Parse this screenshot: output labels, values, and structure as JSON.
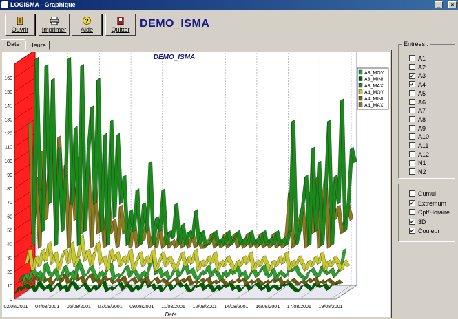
{
  "window": {
    "title": "LOGISMA - Graphique"
  },
  "toolbar": [
    {
      "label": "Ouvrir",
      "icon": "open-door-icon"
    },
    {
      "label": "Imprimer",
      "icon": "printer-icon"
    },
    {
      "label": "Aide",
      "icon": "help-icon"
    },
    {
      "label": "Quitter",
      "icon": "exit-door-icon"
    }
  ],
  "header": {
    "title": "DEMO_ISMA"
  },
  "tabs": [
    {
      "label": "Date",
      "active": true
    },
    {
      "label": "Heure",
      "active": false
    }
  ],
  "entries": {
    "title": "Entrées :",
    "items": [
      {
        "label": "A1",
        "checked": false
      },
      {
        "label": "A2",
        "checked": false
      },
      {
        "label": "A3",
        "checked": true
      },
      {
        "label": "A4",
        "checked": true
      },
      {
        "label": "A5",
        "checked": false
      },
      {
        "label": "A6",
        "checked": false
      },
      {
        "label": "A7",
        "checked": false
      },
      {
        "label": "A8",
        "checked": false
      },
      {
        "label": "A9",
        "checked": false
      },
      {
        "label": "A10",
        "checked": false
      },
      {
        "label": "A11",
        "checked": false
      },
      {
        "label": "A12",
        "checked": false
      },
      {
        "label": "N1",
        "checked": false
      },
      {
        "label": "N2",
        "checked": false
      }
    ]
  },
  "options": {
    "items": [
      {
        "label": "Cumul",
        "checked": false
      },
      {
        "label": "Extremum",
        "checked": true
      },
      {
        "label": "Cpt/Horaire",
        "checked": false
      },
      {
        "label": "3D",
        "checked": true
      },
      {
        "label": "Couleur",
        "checked": true
      }
    ]
  },
  "chart_data": {
    "type": "line",
    "title": "DEMO_ISMA",
    "xlabel": "Date",
    "ylabel": "",
    "ylim": [
      0,
      170
    ],
    "yticks": [
      0,
      10,
      20,
      30,
      40,
      50,
      60,
      70,
      80,
      90,
      100,
      110,
      120,
      130,
      140,
      150,
      160
    ],
    "categories": [
      "02/08/2001",
      "04/08/2001",
      "06/08/2001",
      "07/08/2001",
      "09/08/2001",
      "11/08/2001",
      "12/08/2001",
      "14/08/2001",
      "16/08/2001",
      "17/08/2001",
      "19/08/2001"
    ],
    "colors": {
      "wall": "#ff2020",
      "gridline": "#a0a0a0",
      "background": "#ffffff"
    },
    "series": [
      {
        "name": "A3_MOY",
        "color": "#30a030",
        "values": [
          8,
          14,
          10,
          18,
          12,
          16,
          9,
          22,
          15,
          12,
          18,
          10,
          14,
          20,
          12,
          16,
          10,
          24,
          18,
          12,
          15,
          20,
          14,
          10,
          16,
          12,
          18,
          22,
          10,
          14,
          12,
          16,
          20,
          12,
          18,
          14,
          10,
          16,
          12,
          20,
          28,
          14,
          18,
          12,
          16,
          10,
          14,
          20,
          12,
          16,
          22,
          14,
          18,
          12,
          10,
          16,
          14,
          20,
          12,
          18,
          14,
          10,
          16,
          12,
          18,
          14,
          20,
          12,
          16,
          10,
          14,
          18,
          12,
          16,
          20,
          14,
          12,
          18,
          10,
          16,
          14,
          12,
          18,
          16,
          20,
          14,
          12,
          10,
          16,
          18,
          14,
          12,
          20,
          16,
          14,
          18,
          12,
          16,
          20,
          32
        ]
      },
      {
        "name": "A3_MINI",
        "color": "#006000",
        "values": [
          4,
          8,
          6,
          10,
          7,
          9,
          5,
          12,
          8,
          6,
          10,
          5,
          8,
          11,
          6,
          9,
          5,
          12,
          10,
          6,
          8,
          11,
          7,
          5,
          9,
          6,
          10,
          12,
          5,
          8,
          6,
          9,
          11,
          6,
          10,
          8,
          5,
          9,
          6,
          11,
          14,
          8,
          10,
          6,
          9,
          5,
          8,
          11,
          6,
          9,
          12,
          8,
          10,
          6,
          5,
          9,
          8,
          11,
          6,
          10,
          8,
          5,
          9,
          6,
          10,
          8,
          11,
          6,
          9,
          5,
          8,
          10,
          6,
          9,
          11,
          8,
          6,
          10,
          5,
          9,
          8,
          6,
          10,
          9,
          11,
          8,
          6,
          5,
          9,
          10,
          8,
          6,
          11,
          9,
          8,
          10,
          6,
          9,
          11,
          10
        ]
      },
      {
        "name": "A3_MAXI",
        "color": "#1a8a1a",
        "values": [
          30,
          165,
          70,
          40,
          160,
          60,
          150,
          30,
          100,
          40,
          80,
          165,
          60,
          115,
          30,
          160,
          40,
          100,
          130,
          60,
          150,
          40,
          110,
          30,
          120,
          50,
          110,
          60,
          80,
          30,
          55,
          40,
          70,
          30,
          60,
          40,
          90,
          30,
          50,
          40,
          70,
          30,
          40,
          35,
          60,
          30,
          45,
          30,
          40,
          35,
          55,
          30,
          40,
          30,
          30,
          35,
          40,
          30,
          35,
          30,
          40,
          30,
          35,
          40,
          30,
          35,
          30,
          40,
          30,
          35,
          30,
          40,
          30,
          35,
          30,
          40,
          30,
          35,
          30,
          40,
          120,
          30,
          40,
          60,
          80,
          30,
          100,
          40,
          90,
          30,
          70,
          120,
          30,
          80,
          60,
          135,
          40,
          60,
          100,
          90
        ]
      },
      {
        "name": "A4_MOY",
        "color": "#c8c830",
        "values": [
          20,
          30,
          15,
          25,
          18,
          30,
          22,
          35,
          20,
          28,
          15,
          25,
          30,
          20,
          35,
          18,
          25,
          40,
          22,
          30,
          18,
          28,
          35,
          20,
          25,
          15,
          30,
          22,
          28,
          18,
          25,
          20,
          30,
          15,
          22,
          28,
          18,
          25,
          20,
          30,
          15,
          22,
          28,
          18,
          25,
          20,
          15,
          22,
          28,
          18,
          25,
          20,
          30,
          15,
          22,
          18,
          25,
          20,
          28,
          15,
          22,
          18,
          25,
          20,
          15,
          22,
          18,
          25,
          20,
          28,
          15,
          22,
          18,
          25,
          20,
          15,
          22,
          18,
          25,
          20,
          28,
          15,
          22,
          18,
          25,
          20,
          15,
          22,
          18,
          25,
          20,
          28,
          15,
          22,
          18,
          25,
          20,
          15,
          22,
          18
        ]
      },
      {
        "name": "A4_MINI",
        "color": "#706010",
        "values": [
          10,
          15,
          8,
          12,
          9,
          14,
          11,
          16,
          10,
          13,
          8,
          12,
          14,
          10,
          16,
          9,
          12,
          18,
          11,
          14,
          9,
          13,
          16,
          10,
          12,
          8,
          14,
          11,
          13,
          9,
          12,
          10,
          14,
          8,
          11,
          13,
          9,
          12,
          10,
          14,
          8,
          11,
          13,
          9,
          12,
          10,
          8,
          11,
          13,
          9,
          12,
          10,
          14,
          8,
          11,
          9,
          12,
          10,
          13,
          8,
          11,
          9,
          12,
          10,
          8,
          11,
          9,
          12,
          10,
          13,
          8,
          11,
          9,
          12,
          10,
          8,
          11,
          9,
          12,
          10,
          13,
          8,
          11,
          9,
          12,
          10,
          8,
          11,
          9,
          12,
          10,
          13,
          8,
          11,
          9,
          12,
          10,
          8,
          11,
          9
        ]
      },
      {
        "name": "A4_MAXI",
        "color": "#8a7a20",
        "values": [
          120,
          40,
          80,
          30,
          100,
          50,
          90,
          115,
          40,
          110,
          60,
          90,
          30,
          85,
          50,
          95,
          40,
          70,
          90,
          30,
          80,
          40,
          60,
          30,
          70,
          40,
          50,
          30,
          60,
          40,
          45,
          30,
          50,
          30,
          40,
          35,
          50,
          30,
          40,
          30,
          45,
          30,
          40,
          30,
          35,
          30,
          40,
          30,
          35,
          30,
          40,
          30,
          35,
          30,
          30,
          35,
          40,
          30,
          35,
          30,
          40,
          30,
          35,
          40,
          30,
          35,
          30,
          40,
          30,
          35,
          30,
          40,
          30,
          35,
          30,
          40,
          30,
          35,
          30,
          40,
          70,
          30,
          40,
          50,
          60,
          30,
          70,
          40,
          80,
          30,
          60,
          80,
          30,
          70,
          50,
          60,
          40,
          50,
          60,
          50
        ]
      }
    ]
  }
}
